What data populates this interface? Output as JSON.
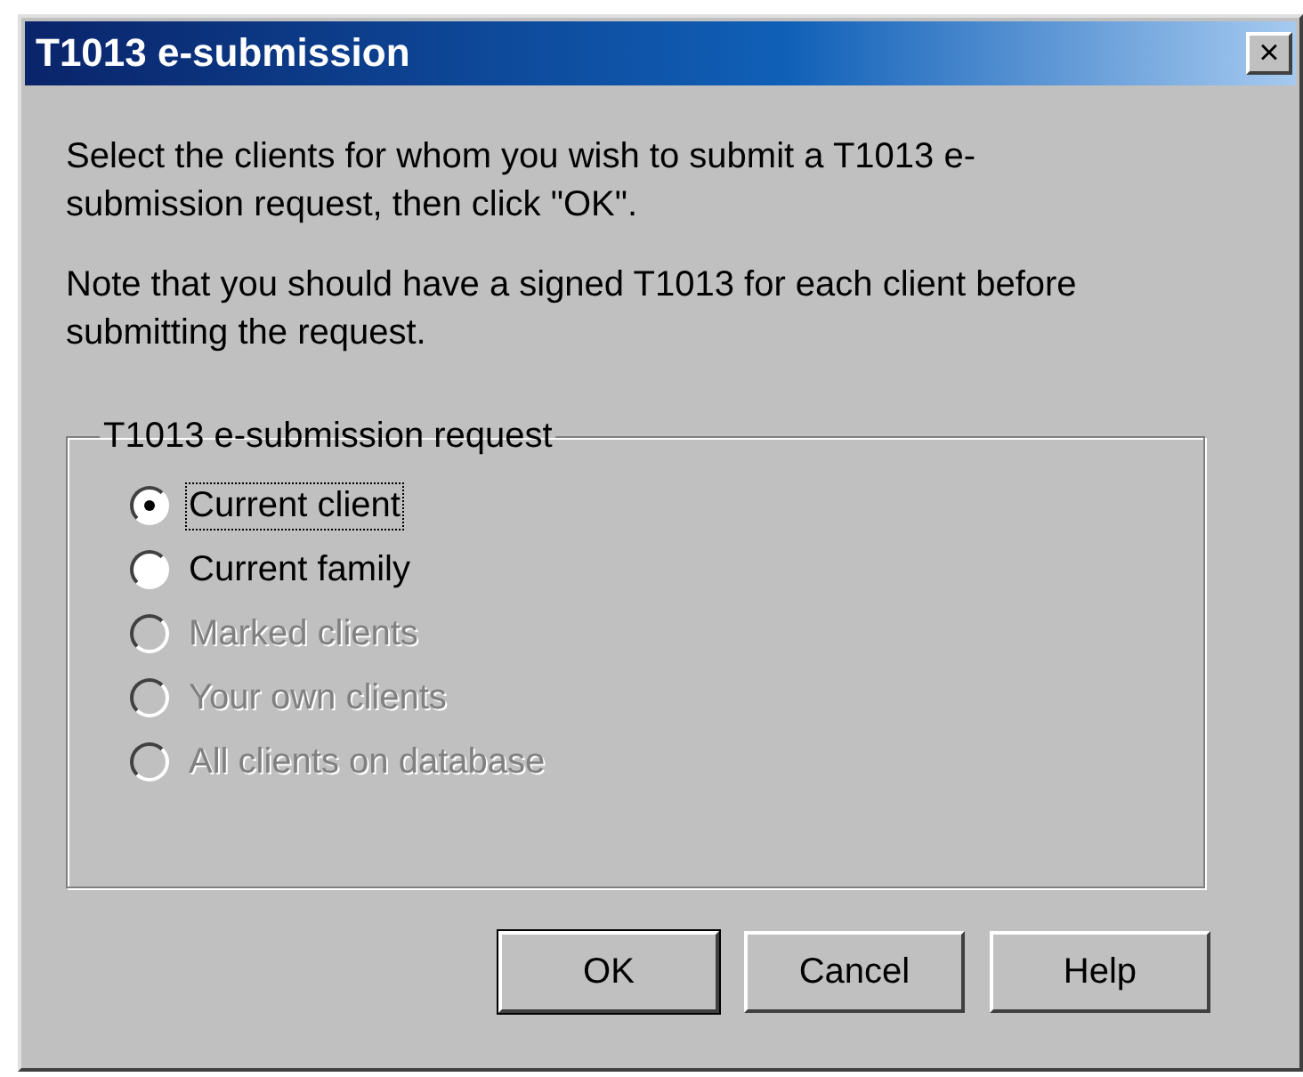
{
  "window": {
    "title": "T1013 e-submission",
    "close": "×"
  },
  "instructions": [
    "Select the clients for whom you wish to submit a T1013 e-submission request, then click \"OK\".",
    "Note that you should have a signed T1013 for each client before submitting the request."
  ],
  "group": {
    "title": "T1013 e-submission request",
    "options": [
      {
        "label": "Current client",
        "selected": true,
        "disabled": false,
        "focused": true
      },
      {
        "label": "Current family",
        "selected": false,
        "disabled": false,
        "focused": false
      },
      {
        "label": "Marked clients",
        "selected": false,
        "disabled": true,
        "focused": false
      },
      {
        "label": "Your own clients",
        "selected": false,
        "disabled": true,
        "focused": false
      },
      {
        "label": "All clients on database",
        "selected": false,
        "disabled": true,
        "focused": false
      }
    ]
  },
  "buttons": [
    {
      "label": "OK",
      "default": true
    },
    {
      "label": "Cancel",
      "default": false
    },
    {
      "label": "Help",
      "default": false
    }
  ]
}
